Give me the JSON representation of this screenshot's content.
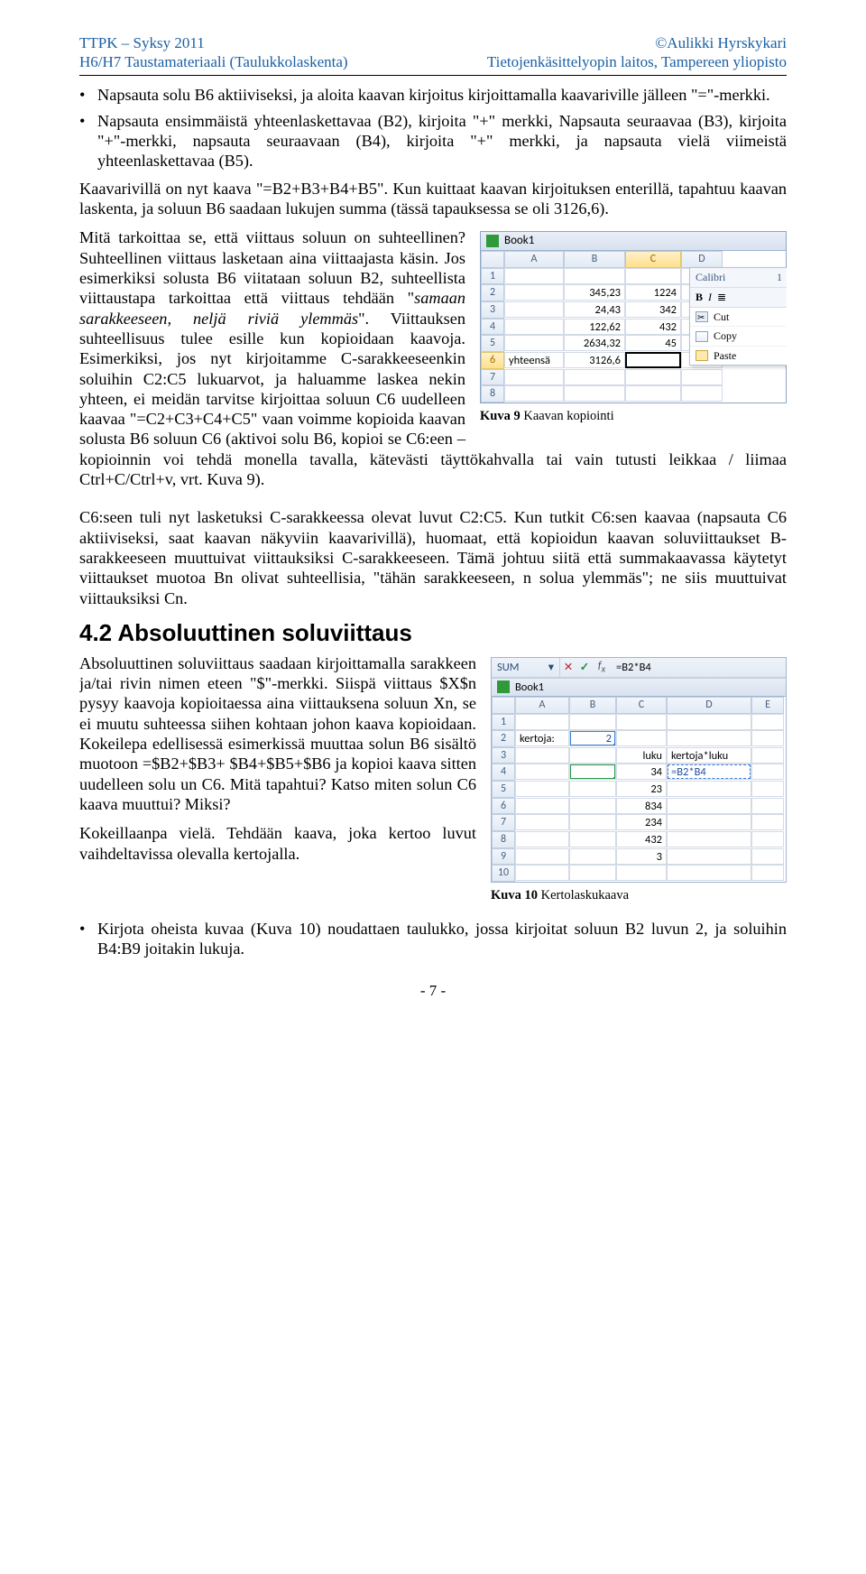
{
  "header": {
    "tl": "TTPK – Syksy 2011",
    "tr": "©Aulikki Hyrskykari",
    "bl": "H6/H7 Taustamateriaali (Taulukkolaskenta)",
    "br": "Tietojenkäsittelyopin laitos, Tampereen yliopisto"
  },
  "bullets1": [
    "Napsauta solu B6 aktiiviseksi, ja aloita kaavan kirjoitus kirjoittamalla kaavariville jälleen \"=\"-merkki.",
    "Napsauta ensimmäistä yhteenlaskettavaa (B2), kirjoita \"+\" merkki, Napsauta seuraavaa (B3), kirjoita \"+\"-merkki, napsauta seuraavaan (B4), kirjoita \"+\" merkki, ja napsauta vielä viimeistä yhteenlaskettavaa (B5)."
  ],
  "para1": "Kaavarivillä on nyt kaava \"=B2+B3+B4+B5\". Kun kuittaat kaavan kirjoituksen enterillä, tapahtuu kaavan laskenta, ja soluun B6 saadaan lukujen summa (tässä tapauksessa se oli 3126,6).",
  "para2a": "Mitä tarkoittaa se, että viittaus soluun on suhteellinen? Suhteellinen viittaus lasketaan aina viittaajasta käsin. Jos esimerkiksi solusta B6 viitataan soluun B2, suhteellista viittaustapa tarkoittaa että viittaus tehdään \"",
  "para2_em1": "samaan sarakkeeseen, neljä riviä ylemmäs",
  "para2b": "\". Viittauksen suhteellisuus tulee esille kun kopioidaan kaavoja. Esimerkiksi, jos nyt kirjoitamme C-sarakkeeseenkin soluihin C2:C5 lukuarvot, ja haluamme laskea nekin yhteen, ei meidän tarvitse kirjoittaa soluun C6 uudelleen kaavaa \"=C2+C3+C4+C5\" vaan voimme kopioida kaavan solusta B6 soluun C6 (aktivoi solu B6, kopioi se C6:een – kopioinnin voi tehdä monella tavalla, kätevästi täyttökahvalla tai vain tutusti leikkaa / liimaa Ctrl+C/Ctrl+v, vrt. Kuva 9).",
  "para3": "C6:seen tuli nyt lasketuksi C-sarakkeessa olevat luvut C2:C5. Kun tutkit C6:sen kaavaa (napsauta C6 aktiiviseksi, saat kaavan näkyviin kaavarivillä), huomaat, että kopioidun kaavan soluviittaukset B-sarakkeeseen muuttuivat viittauksiksi C-sarakkeeseen. Tämä johtuu siitä että summakaavassa käytetyt viittaukset muotoa Bn olivat suhteellisia, \"tähän sarakkeeseen, n solua ylemmäs\"; ne siis muuttuivat viittauksiksi Cn.",
  "sec42": "4.2 Absoluuttinen soluviittaus",
  "para4a": "Absoluuttinen soluviittaus saadaan kirjoittamalla sarakkeen ja/tai rivin nimen eteen \"$\"-merkki. Siispä viittaus $X$n pysyy kaavoja kopioitaessa aina viittauksena soluun Xn, se ei muutu suhteessa siihen kohtaan johon kaava kopioidaan. Kokeilepa edellisessä esimerkissä muuttaa solun B6 sisältö muotoon =$B2+$B3+ $B4+$B5+$B6 ja kopioi kaava sitten uudelleen solu un C6. Mitä tapahtui? Katso miten solun C6 kaava muuttui? Miksi?",
  "para4b": "Kokeillaanpa vielä. Tehdään kaava, joka kertoo luvut vaihdeltavissa olevalla kertojalla.",
  "bullet_last": "Kirjota oheista kuvaa (Kuva 10) noudattaen taulukko, jossa kirjoitat soluun B2 luvun 2, ja soluihin B4:B9 joitakin lukuja.",
  "fig9cap_b": "Kuva 9",
  "fig9cap_t": " Kaavan kopiointi",
  "fig10cap_b": "Kuva 10",
  "fig10cap_t": " Kertolaskukaava",
  "pagenum": "- 7 -",
  "fig9": {
    "title": "Book1",
    "cols": [
      "A",
      "B",
      "C",
      "D"
    ],
    "rows": [
      {
        "n": "1",
        "A": "",
        "B": "",
        "C": "",
        "D": ""
      },
      {
        "n": "2",
        "A": "",
        "B": "345,23",
        "C": "1224",
        "D": ""
      },
      {
        "n": "3",
        "A": "",
        "B": "24,43",
        "C": "342",
        "D": ""
      },
      {
        "n": "4",
        "A": "",
        "B": "122,62",
        "C": "432",
        "D": ""
      },
      {
        "n": "5",
        "A": "",
        "B": "2634,32",
        "C": "45",
        "D": ""
      },
      {
        "n": "6",
        "A": "yhteensä",
        "B": "3126,6",
        "C": "",
        "D": ""
      },
      {
        "n": "7",
        "A": "",
        "B": "",
        "C": "",
        "D": ""
      },
      {
        "n": "8",
        "A": "",
        "B": "",
        "C": "",
        "D": ""
      }
    ],
    "ctx_font": "Calibri",
    "ctx_size": "1",
    "ctx_bi": "B  I  ≡",
    "ctx_items": [
      "Cut",
      "Copy",
      "Paste"
    ]
  },
  "fig10": {
    "name": "SUM",
    "fx": "=B2*B4",
    "title": "Book1",
    "cols": [
      "A",
      "B",
      "C",
      "D",
      "E"
    ],
    "rows": [
      {
        "n": "1",
        "A": "",
        "B": "",
        "C": "",
        "D": "",
        "E": ""
      },
      {
        "n": "2",
        "A": "kertoja:",
        "B": "2",
        "C": "",
        "D": "",
        "E": ""
      },
      {
        "n": "3",
        "A": "",
        "B": "",
        "C": "luku",
        "D": "kertoja*luku",
        "E": ""
      },
      {
        "n": "4",
        "A": "",
        "B": "",
        "C": "34",
        "D": "=B2*B4",
        "E": ""
      },
      {
        "n": "5",
        "A": "",
        "B": "",
        "C": "23",
        "D": "",
        "E": ""
      },
      {
        "n": "6",
        "A": "",
        "B": "",
        "C": "834",
        "D": "",
        "E": ""
      },
      {
        "n": "7",
        "A": "",
        "B": "",
        "C": "234",
        "D": "",
        "E": ""
      },
      {
        "n": "8",
        "A": "",
        "B": "",
        "C": "432",
        "D": "",
        "E": ""
      },
      {
        "n": "9",
        "A": "",
        "B": "",
        "C": "3",
        "D": "",
        "E": ""
      },
      {
        "n": "10",
        "A": "",
        "B": "",
        "C": "",
        "D": "",
        "E": ""
      }
    ]
  }
}
